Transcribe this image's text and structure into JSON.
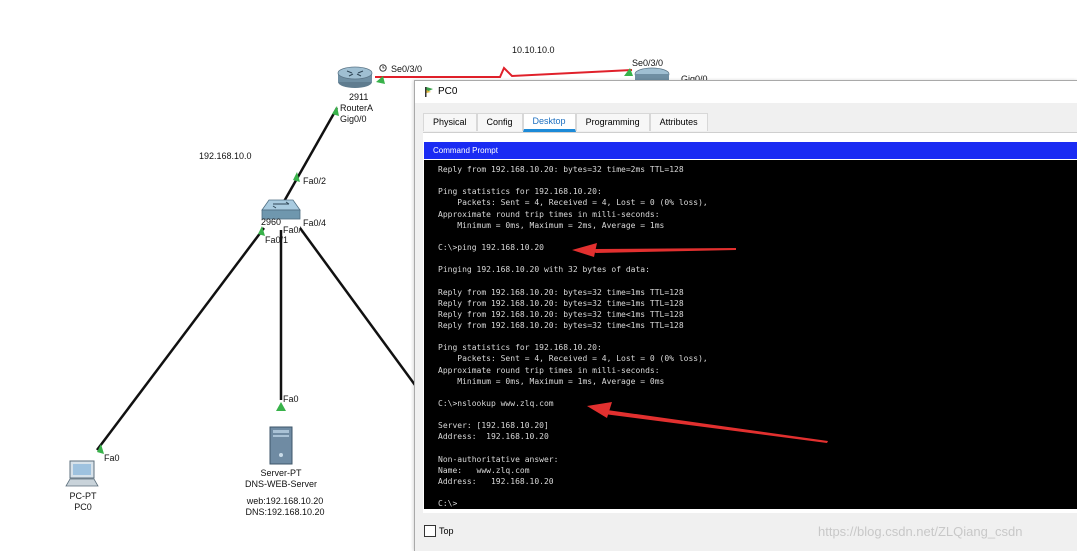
{
  "topology": {
    "networks": {
      "wan": "10.10.10.0",
      "lan": "192.168.10.0"
    },
    "router": {
      "model": "2911",
      "name": "RouterA",
      "port_up": "Gig0/0",
      "port_serial": "Se0/3/0"
    },
    "router_b": {
      "port_serial": "Se0/3/0",
      "port_partial": "Gig0/0"
    },
    "switch": {
      "model": "2960",
      "port_fa02": "Fa0/2",
      "port_fa04": "Fa0/4",
      "port_fa0x": "Fa0/.",
      "port_fa01": "Fa0/1"
    },
    "pc": {
      "port": "Fa0",
      "type": "PC-PT",
      "name": "PC0"
    },
    "server": {
      "port": "Fa0",
      "type": "Server-PT",
      "name": "DNS-WEB-Server",
      "web": "web:192.168.10.20",
      "dns": "DNS:192.168.10.20"
    }
  },
  "window": {
    "title": "PC0",
    "tabs": [
      "Physical",
      "Config",
      "Desktop",
      "Programming",
      "Attributes"
    ],
    "active_tab": "Desktop",
    "app_title": "Command Prompt",
    "top_checkbox_label": "Top",
    "top_checked": false
  },
  "terminal": {
    "lines": [
      "Reply from 192.168.10.20: bytes=32 time=2ms TTL=128",
      "",
      "Ping statistics for 192.168.10.20:",
      "    Packets: Sent = 4, Received = 4, Lost = 0 (0% loss),",
      "Approximate round trip times in milli-seconds:",
      "    Minimum = 0ms, Maximum = 2ms, Average = 1ms",
      "",
      "C:\\>ping 192.168.10.20",
      "",
      "Pinging 192.168.10.20 with 32 bytes of data:",
      "",
      "Reply from 192.168.10.20: bytes=32 time=1ms TTL=128",
      "Reply from 192.168.10.20: bytes=32 time=1ms TTL=128",
      "Reply from 192.168.10.20: bytes=32 time<1ms TTL=128",
      "Reply from 192.168.10.20: bytes=32 time<1ms TTL=128",
      "",
      "Ping statistics for 192.168.10.20:",
      "    Packets: Sent = 4, Received = 4, Lost = 0 (0% loss),",
      "Approximate round trip times in milli-seconds:",
      "    Minimum = 0ms, Maximum = 1ms, Average = 0ms",
      "",
      "C:\\>nslookup www.zlq.com",
      "",
      "Server: [192.168.10.20]",
      "Address:  192.168.10.20",
      "",
      "Non-authoritative answer:",
      "Name:   www.zlq.com",
      "Address:   192.168.10.20",
      "",
      "C:\\>"
    ]
  },
  "watermark": "https://blog.csdn.net/ZLQiang_csdn",
  "colors": {
    "serial_link": "#e0202a",
    "ethernet_link": "#111111",
    "port_up": "#38b24a",
    "title_bar": "#1a2bf3",
    "active_tab": "#1c8ad8",
    "annotation_arrow": "#e2302f"
  }
}
